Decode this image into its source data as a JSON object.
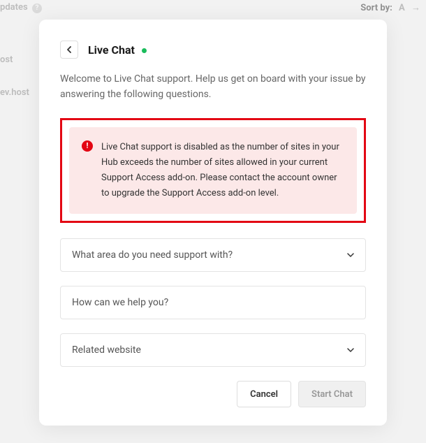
{
  "background": {
    "updates_label": "pdates",
    "sort_label": "Sort by:",
    "sort_value": "A",
    "host1": "ost",
    "host2": "ev.host"
  },
  "modal": {
    "title": "Live Chat",
    "intro": "Welcome to Live Chat support. Help us get on board with your issue by answering the following questions.",
    "alert": "Live Chat support is disabled as the number of sites in your Hub exceeds the number of sites allowed in your current Support Access add-on. Please contact the account owner to upgrade the Support Access add-on level.",
    "area_select": "What area do you need support with?",
    "help_input": "How can we help you?",
    "website_select": "Related website",
    "cancel": "Cancel",
    "start": "Start Chat"
  }
}
